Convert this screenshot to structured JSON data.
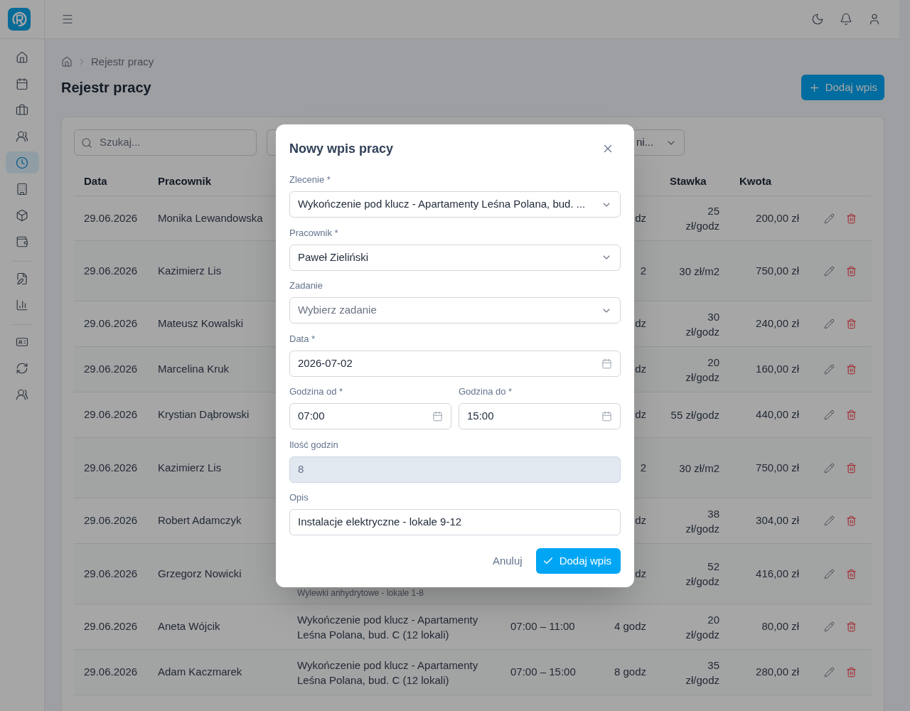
{
  "sidebar": {
    "groups": [
      {
        "items": [
          {
            "selected": false
          },
          {
            "selected": false
          },
          {
            "selected": false
          },
          {
            "selected": false
          },
          {
            "selected": true
          },
          {
            "selected": false
          },
          {
            "selected": false
          },
          {
            "selected": false
          }
        ]
      },
      {
        "items": [
          {
            "selected": false
          },
          {
            "selected": false
          }
        ]
      },
      {
        "items": [
          {
            "selected": false
          },
          {
            "selected": false
          },
          {
            "selected": false
          }
        ]
      }
    ]
  },
  "breadcrumb": {
    "items": [
      "Rejestr pracy"
    ]
  },
  "page": {
    "title": "Rejestr pracy",
    "add_button": "Dodaj wpis"
  },
  "filters": {
    "search": {
      "placeholder": "Szukaj..."
    },
    "select": {
      "value": "ni..."
    }
  },
  "table": {
    "columns": {
      "date": "Data",
      "worker": "Pracownik",
      "rate": "Stawka",
      "amount": "Kwota"
    },
    "rows": [
      {
        "date": "29.06.2026",
        "worker": "Monika Lewandowska",
        "hours": "dz",
        "rate": [
          "25",
          "zł/godz"
        ],
        "amount": "200,00 zł"
      },
      {
        "date": "29.06.2026",
        "worker": "Kazimierz Lis",
        "hours": "2",
        "rate": [
          "30 zł/m2"
        ],
        "amount": "750,00 zł"
      },
      {
        "date": "29.06.2026",
        "worker": "Mateusz Kowalski",
        "hours": "dz",
        "rate": [
          "30",
          "zł/godz"
        ],
        "amount": "240,00 zł"
      },
      {
        "date": "29.06.2026",
        "worker": "Marcelina Kruk",
        "hours": "dz",
        "rate": [
          "20",
          "zł/godz"
        ],
        "amount": "160,00 zł"
      },
      {
        "date": "29.06.2026",
        "worker": "Krystian Dąbrowski",
        "hours": "dz",
        "rate": [
          "55 zł/godz"
        ],
        "amount": "440,00 zł"
      },
      {
        "date": "29.06.2026",
        "worker": "Kazimierz Lis",
        "hours": "2",
        "rate": [
          "30 zł/m2"
        ],
        "amount": "750,00 zł"
      },
      {
        "date": "29.06.2026",
        "worker": "Robert Adamczyk",
        "hours": "dz",
        "rate": [
          "38",
          "zł/godz"
        ],
        "amount": "304,00 zł"
      },
      {
        "date": "29.06.2026",
        "worker": "Grzegorz Nowicki",
        "task": "Wylewki anhydrytowe - lokale 1-8",
        "hours": "dz",
        "rate": [
          "52",
          "zł/godz"
        ],
        "amount": "416,00 zł"
      },
      {
        "date": "29.06.2026",
        "worker": "Aneta Wójcik",
        "order": "Wykończenie pod klucz - Apartamenty Leśna Polana, bud. C (12 lokali)",
        "time": "07:00 – 11:00",
        "hours": "4 godz",
        "rate": [
          "20",
          "zł/godz"
        ],
        "amount": "80,00 zł"
      },
      {
        "date": "29.06.2026",
        "worker": "Adam Kaczmarek",
        "order": "Wykończenie pod klucz - Apartamenty Leśna Polana, bud. C (12 lokali)",
        "time": "07:00 – 15:00",
        "hours": "8 godz",
        "rate": [
          "35",
          "zł/godz"
        ],
        "amount": "280,00 zł"
      }
    ]
  },
  "dialog": {
    "title": "Nowy wpis pracy",
    "rows": [
      {
        "fields": [
          {
            "kind": "select",
            "label": "Zlecenie *",
            "value": "Wykończenie pod klucz - Apartamenty Leśna Polana, bud. ...",
            "disabled": false
          }
        ]
      },
      {
        "fields": [
          {
            "kind": "select",
            "label": "Pracownik *",
            "value": "Paweł Zieliński",
            "disabled": false
          }
        ]
      },
      {
        "fields": [
          {
            "kind": "select",
            "label": "Zadanie",
            "placeholder": "Wybierz zadanie",
            "disabled": false
          }
        ]
      },
      {
        "fields": [
          {
            "kind": "date",
            "label": "Data *",
            "value": "2026-07-02",
            "disabled": false
          }
        ]
      },
      {
        "fields": [
          {
            "kind": "time",
            "label": "Godzina od *",
            "value": "07:00",
            "disabled": false
          },
          {
            "kind": "time",
            "label": "Godzina do *",
            "value": "15:00",
            "disabled": false
          }
        ]
      },
      {
        "fields": [
          {
            "kind": "text",
            "label": "Ilość godzin",
            "value": "8",
            "disabled": true
          }
        ]
      },
      {
        "fields": [
          {
            "kind": "text",
            "label": "Opis",
            "value": "Instalacje elektryczne - lokale 9-12",
            "disabled": false
          }
        ]
      }
    ],
    "buttons": [
      {
        "kind": "secondary",
        "label": "Anuluj"
      },
      {
        "kind": "primary",
        "label": "Dodaj wpis"
      }
    ]
  }
}
